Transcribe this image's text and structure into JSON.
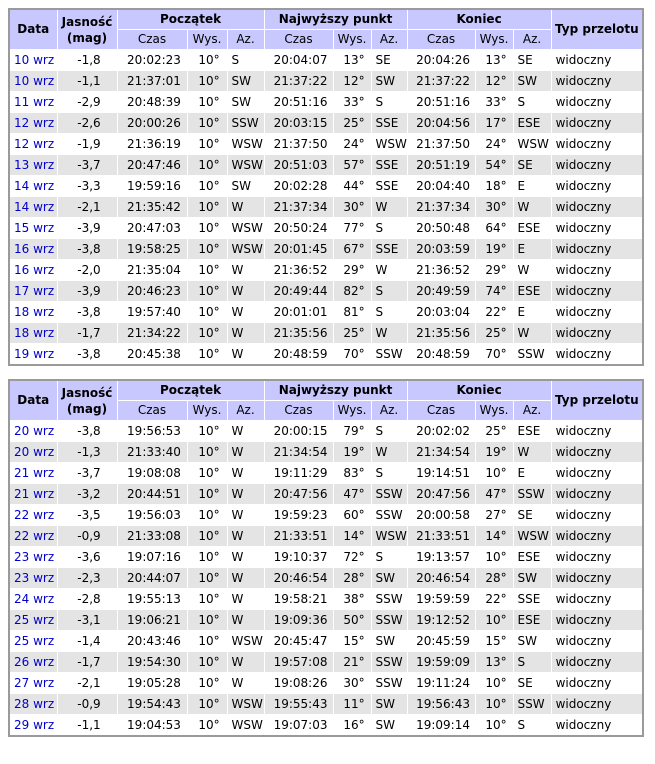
{
  "headers": {
    "date": "Data",
    "mag_top": "Jasność",
    "mag_bottom": "(mag)",
    "start": "Początek",
    "highest": "Najwyższy punkt",
    "end": "Koniec",
    "type": "Typ przelotu",
    "time": "Czas",
    "alt": "Wys.",
    "az": "Az."
  },
  "tables": [
    {
      "rows": [
        {
          "date": "10 wrz",
          "mag": "-1,8",
          "s_time": "20:02:23",
          "s_alt": "10°",
          "s_az": "S",
          "h_time": "20:04:07",
          "h_alt": "13°",
          "h_az": "SE",
          "e_time": "20:04:26",
          "e_alt": "13°",
          "e_az": "SE",
          "type": "widoczny"
        },
        {
          "date": "10 wrz",
          "mag": "-1,1",
          "s_time": "21:37:01",
          "s_alt": "10°",
          "s_az": "SW",
          "h_time": "21:37:22",
          "h_alt": "12°",
          "h_az": "SW",
          "e_time": "21:37:22",
          "e_alt": "12°",
          "e_az": "SW",
          "type": "widoczny"
        },
        {
          "date": "11 wrz",
          "mag": "-2,9",
          "s_time": "20:48:39",
          "s_alt": "10°",
          "s_az": "SW",
          "h_time": "20:51:16",
          "h_alt": "33°",
          "h_az": "S",
          "e_time": "20:51:16",
          "e_alt": "33°",
          "e_az": "S",
          "type": "widoczny"
        },
        {
          "date": "12 wrz",
          "mag": "-2,6",
          "s_time": "20:00:26",
          "s_alt": "10°",
          "s_az": "SSW",
          "h_time": "20:03:15",
          "h_alt": "25°",
          "h_az": "SSE",
          "e_time": "20:04:56",
          "e_alt": "17°",
          "e_az": "ESE",
          "type": "widoczny"
        },
        {
          "date": "12 wrz",
          "mag": "-1,9",
          "s_time": "21:36:19",
          "s_alt": "10°",
          "s_az": "WSW",
          "h_time": "21:37:50",
          "h_alt": "24°",
          "h_az": "WSW",
          "e_time": "21:37:50",
          "e_alt": "24°",
          "e_az": "WSW",
          "type": "widoczny"
        },
        {
          "date": "13 wrz",
          "mag": "-3,7",
          "s_time": "20:47:46",
          "s_alt": "10°",
          "s_az": "WSW",
          "h_time": "20:51:03",
          "h_alt": "57°",
          "h_az": "SSE",
          "e_time": "20:51:19",
          "e_alt": "54°",
          "e_az": "SE",
          "type": "widoczny"
        },
        {
          "date": "14 wrz",
          "mag": "-3,3",
          "s_time": "19:59:16",
          "s_alt": "10°",
          "s_az": "SW",
          "h_time": "20:02:28",
          "h_alt": "44°",
          "h_az": "SSE",
          "e_time": "20:04:40",
          "e_alt": "18°",
          "e_az": "E",
          "type": "widoczny"
        },
        {
          "date": "14 wrz",
          "mag": "-2,1",
          "s_time": "21:35:42",
          "s_alt": "10°",
          "s_az": "W",
          "h_time": "21:37:34",
          "h_alt": "30°",
          "h_az": "W",
          "e_time": "21:37:34",
          "e_alt": "30°",
          "e_az": "W",
          "type": "widoczny"
        },
        {
          "date": "15 wrz",
          "mag": "-3,9",
          "s_time": "20:47:03",
          "s_alt": "10°",
          "s_az": "WSW",
          "h_time": "20:50:24",
          "h_alt": "77°",
          "h_az": "S",
          "e_time": "20:50:48",
          "e_alt": "64°",
          "e_az": "ESE",
          "type": "widoczny"
        },
        {
          "date": "16 wrz",
          "mag": "-3,8",
          "s_time": "19:58:25",
          "s_alt": "10°",
          "s_az": "WSW",
          "h_time": "20:01:45",
          "h_alt": "67°",
          "h_az": "SSE",
          "e_time": "20:03:59",
          "e_alt": "19°",
          "e_az": "E",
          "type": "widoczny"
        },
        {
          "date": "16 wrz",
          "mag": "-2,0",
          "s_time": "21:35:04",
          "s_alt": "10°",
          "s_az": "W",
          "h_time": "21:36:52",
          "h_alt": "29°",
          "h_az": "W",
          "e_time": "21:36:52",
          "e_alt": "29°",
          "e_az": "W",
          "type": "widoczny"
        },
        {
          "date": "17 wrz",
          "mag": "-3,9",
          "s_time": "20:46:23",
          "s_alt": "10°",
          "s_az": "W",
          "h_time": "20:49:44",
          "h_alt": "82°",
          "h_az": "S",
          "e_time": "20:49:59",
          "e_alt": "74°",
          "e_az": "ESE",
          "type": "widoczny"
        },
        {
          "date": "18 wrz",
          "mag": "-3,8",
          "s_time": "19:57:40",
          "s_alt": "10°",
          "s_az": "W",
          "h_time": "20:01:01",
          "h_alt": "81°",
          "h_az": "S",
          "e_time": "20:03:04",
          "e_alt": "22°",
          "e_az": "E",
          "type": "widoczny"
        },
        {
          "date": "18 wrz",
          "mag": "-1,7",
          "s_time": "21:34:22",
          "s_alt": "10°",
          "s_az": "W",
          "h_time": "21:35:56",
          "h_alt": "25°",
          "h_az": "W",
          "e_time": "21:35:56",
          "e_alt": "25°",
          "e_az": "W",
          "type": "widoczny"
        },
        {
          "date": "19 wrz",
          "mag": "-3,8",
          "s_time": "20:45:38",
          "s_alt": "10°",
          "s_az": "W",
          "h_time": "20:48:59",
          "h_alt": "70°",
          "h_az": "SSW",
          "e_time": "20:48:59",
          "e_alt": "70°",
          "e_az": "SSW",
          "type": "widoczny"
        }
      ]
    },
    {
      "rows": [
        {
          "date": "20 wrz",
          "mag": "-3,8",
          "s_time": "19:56:53",
          "s_alt": "10°",
          "s_az": "W",
          "h_time": "20:00:15",
          "h_alt": "79°",
          "h_az": "S",
          "e_time": "20:02:02",
          "e_alt": "25°",
          "e_az": "ESE",
          "type": "widoczny"
        },
        {
          "date": "20 wrz",
          "mag": "-1,3",
          "s_time": "21:33:40",
          "s_alt": "10°",
          "s_az": "W",
          "h_time": "21:34:54",
          "h_alt": "19°",
          "h_az": "W",
          "e_time": "21:34:54",
          "e_alt": "19°",
          "e_az": "W",
          "type": "widoczny"
        },
        {
          "date": "21 wrz",
          "mag": "-3,7",
          "s_time": "19:08:08",
          "s_alt": "10°",
          "s_az": "W",
          "h_time": "19:11:29",
          "h_alt": "83°",
          "h_az": "S",
          "e_time": "19:14:51",
          "e_alt": "10°",
          "e_az": "E",
          "type": "widoczny"
        },
        {
          "date": "21 wrz",
          "mag": "-3,2",
          "s_time": "20:44:51",
          "s_alt": "10°",
          "s_az": "W",
          "h_time": "20:47:56",
          "h_alt": "47°",
          "h_az": "SSW",
          "e_time": "20:47:56",
          "e_alt": "47°",
          "e_az": "SSW",
          "type": "widoczny"
        },
        {
          "date": "22 wrz",
          "mag": "-3,5",
          "s_time": "19:56:03",
          "s_alt": "10°",
          "s_az": "W",
          "h_time": "19:59:23",
          "h_alt": "60°",
          "h_az": "SSW",
          "e_time": "20:00:58",
          "e_alt": "27°",
          "e_az": "SE",
          "type": "widoczny"
        },
        {
          "date": "22 wrz",
          "mag": "-0,9",
          "s_time": "21:33:08",
          "s_alt": "10°",
          "s_az": "W",
          "h_time": "21:33:51",
          "h_alt": "14°",
          "h_az": "WSW",
          "e_time": "21:33:51",
          "e_alt": "14°",
          "e_az": "WSW",
          "type": "widoczny"
        },
        {
          "date": "23 wrz",
          "mag": "-3,6",
          "s_time": "19:07:16",
          "s_alt": "10°",
          "s_az": "W",
          "h_time": "19:10:37",
          "h_alt": "72°",
          "h_az": "S",
          "e_time": "19:13:57",
          "e_alt": "10°",
          "e_az": "ESE",
          "type": "widoczny"
        },
        {
          "date": "23 wrz",
          "mag": "-2,3",
          "s_time": "20:44:07",
          "s_alt": "10°",
          "s_az": "W",
          "h_time": "20:46:54",
          "h_alt": "28°",
          "h_az": "SW",
          "e_time": "20:46:54",
          "e_alt": "28°",
          "e_az": "SW",
          "type": "widoczny"
        },
        {
          "date": "24 wrz",
          "mag": "-2,8",
          "s_time": "19:55:13",
          "s_alt": "10°",
          "s_az": "W",
          "h_time": "19:58:21",
          "h_alt": "38°",
          "h_az": "SSW",
          "e_time": "19:59:59",
          "e_alt": "22°",
          "e_az": "SSE",
          "type": "widoczny"
        },
        {
          "date": "25 wrz",
          "mag": "-3,1",
          "s_time": "19:06:21",
          "s_alt": "10°",
          "s_az": "W",
          "h_time": "19:09:36",
          "h_alt": "50°",
          "h_az": "SSW",
          "e_time": "19:12:52",
          "e_alt": "10°",
          "e_az": "ESE",
          "type": "widoczny"
        },
        {
          "date": "25 wrz",
          "mag": "-1,4",
          "s_time": "20:43:46",
          "s_alt": "10°",
          "s_az": "WSW",
          "h_time": "20:45:47",
          "h_alt": "15°",
          "h_az": "SW",
          "e_time": "20:45:59",
          "e_alt": "15°",
          "e_az": "SW",
          "type": "widoczny"
        },
        {
          "date": "26 wrz",
          "mag": "-1,7",
          "s_time": "19:54:30",
          "s_alt": "10°",
          "s_az": "W",
          "h_time": "19:57:08",
          "h_alt": "21°",
          "h_az": "SSW",
          "e_time": "19:59:09",
          "e_alt": "13°",
          "e_az": "S",
          "type": "widoczny"
        },
        {
          "date": "27 wrz",
          "mag": "-2,1",
          "s_time": "19:05:28",
          "s_alt": "10°",
          "s_az": "W",
          "h_time": "19:08:26",
          "h_alt": "30°",
          "h_az": "SSW",
          "e_time": "19:11:24",
          "e_alt": "10°",
          "e_az": "SE",
          "type": "widoczny"
        },
        {
          "date": "28 wrz",
          "mag": "-0,9",
          "s_time": "19:54:43",
          "s_alt": "10°",
          "s_az": "WSW",
          "h_time": "19:55:43",
          "h_alt": "11°",
          "h_az": "SW",
          "e_time": "19:56:43",
          "e_alt": "10°",
          "e_az": "SSW",
          "type": "widoczny"
        },
        {
          "date": "29 wrz",
          "mag": "-1,1",
          "s_time": "19:04:53",
          "s_alt": "10°",
          "s_az": "WSW",
          "h_time": "19:07:03",
          "h_alt": "16°",
          "h_az": "SW",
          "e_time": "19:09:14",
          "e_alt": "10°",
          "e_az": "S",
          "type": "widoczny"
        }
      ]
    }
  ]
}
